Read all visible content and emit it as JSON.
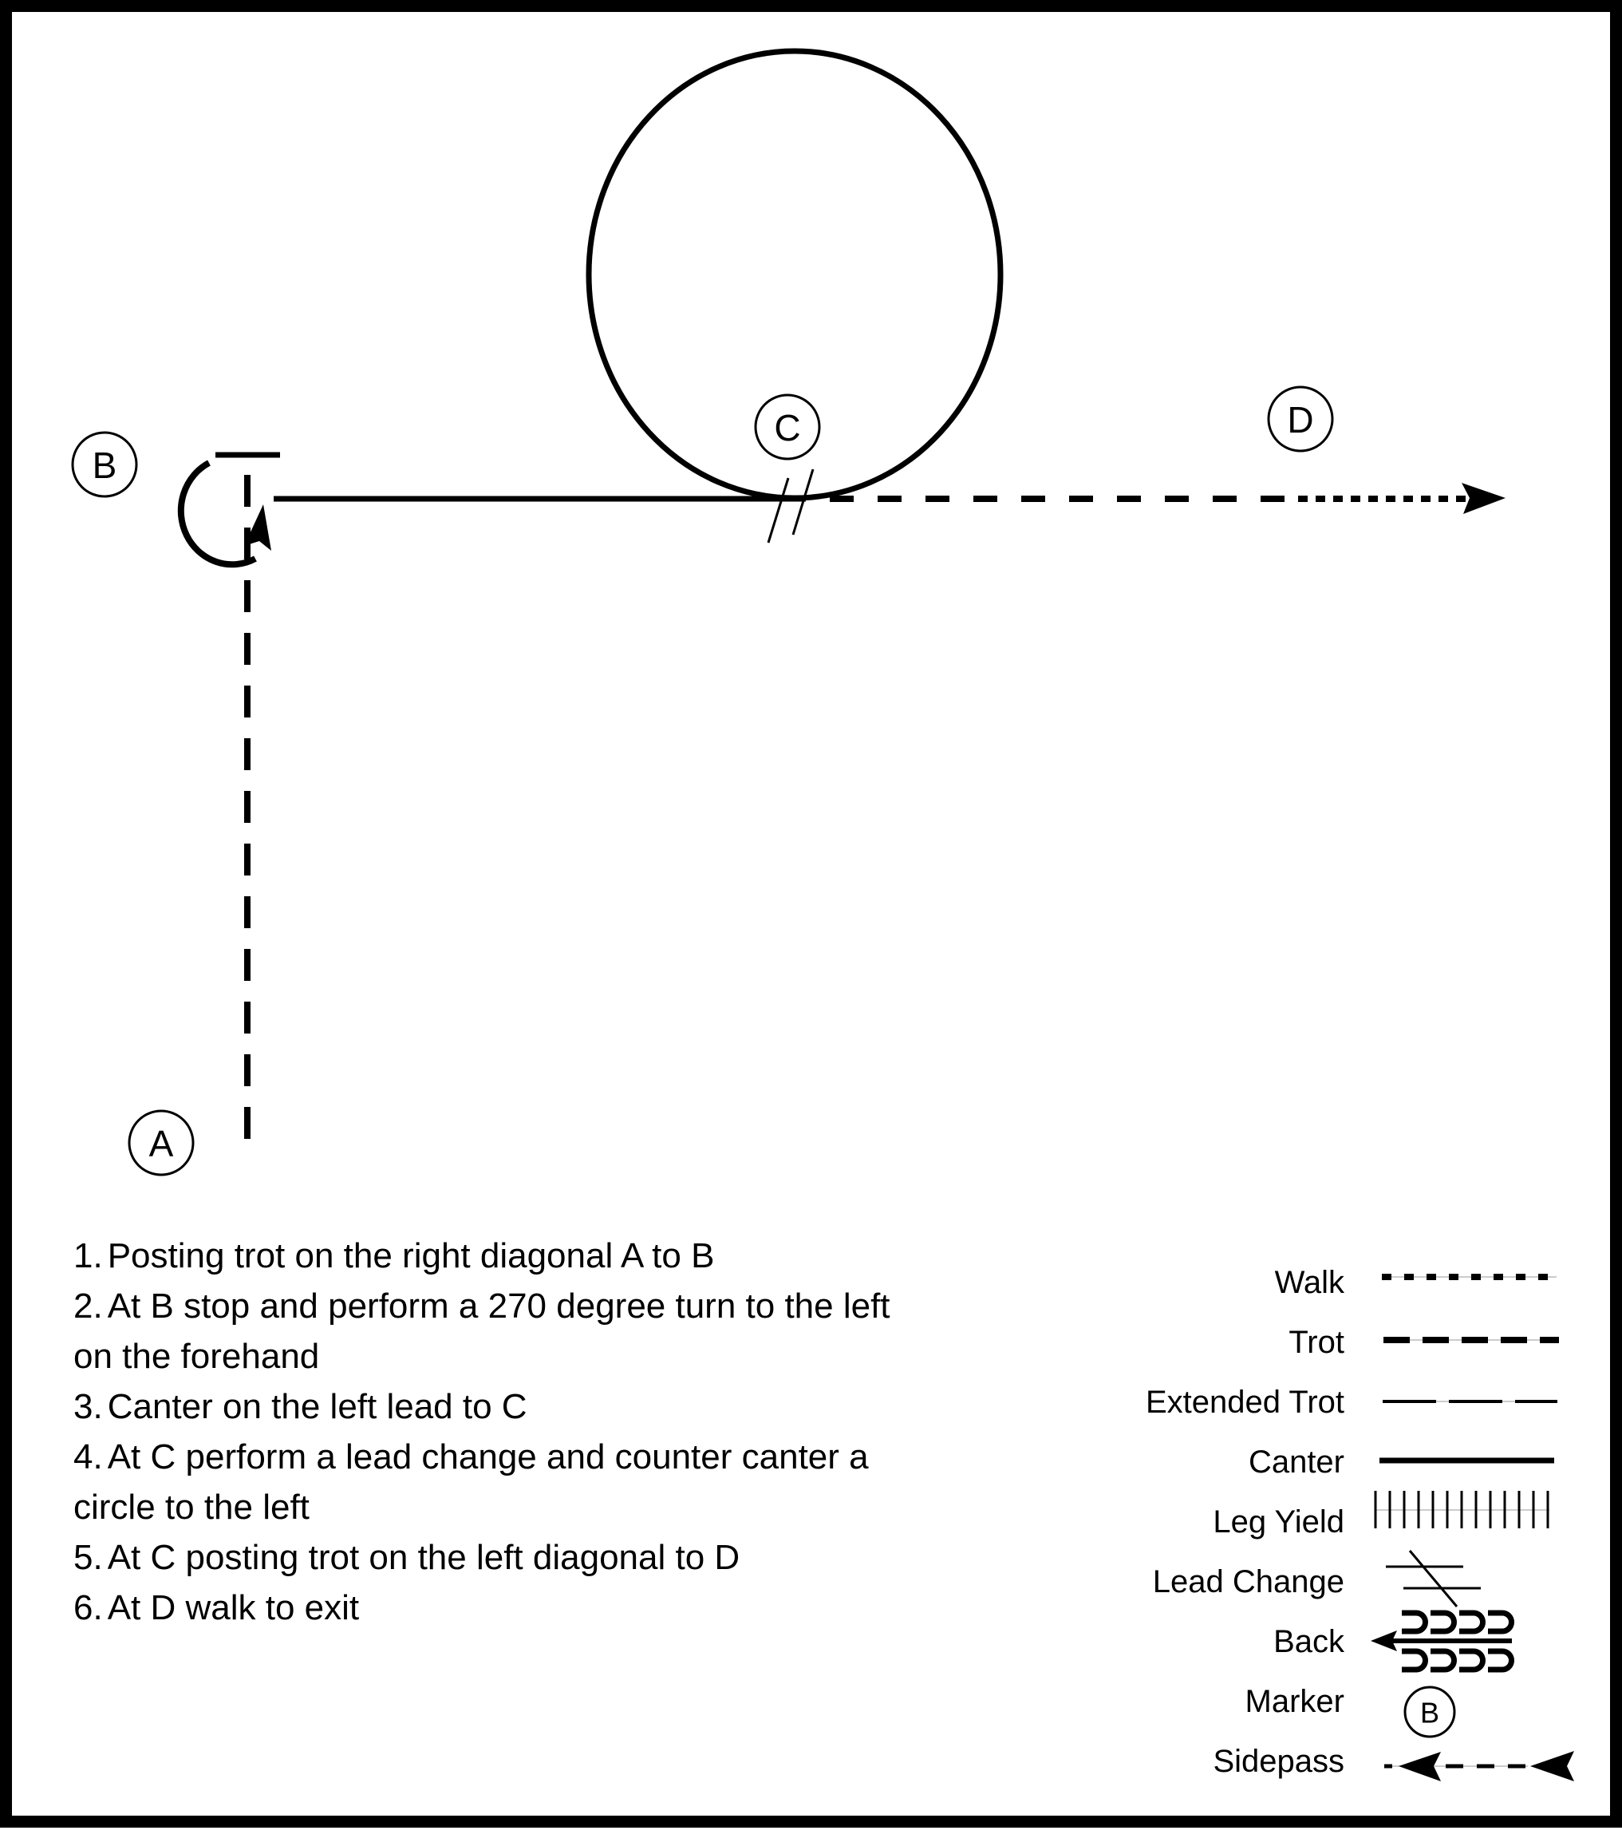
{
  "pattern": {
    "markers": [
      {
        "id": "A",
        "label": "A"
      },
      {
        "id": "B",
        "label": "B"
      },
      {
        "id": "C",
        "label": "C"
      },
      {
        "id": "D",
        "label": "D"
      }
    ],
    "segments": [
      {
        "from": "A",
        "to": "B",
        "gait": "Trot"
      },
      {
        "at": "B",
        "action": "Stop and 270 degree turn on the forehand",
        "symbol": "stop-bar"
      },
      {
        "from": "B",
        "to": "C",
        "gait": "Canter"
      },
      {
        "at": "C",
        "action": "Lead Change",
        "symbol": "lead-change-slashes"
      },
      {
        "at": "C",
        "action": "Counter canter circle to the left",
        "gait": "Canter"
      },
      {
        "from": "C",
        "to": "D",
        "gait": "Trot"
      },
      {
        "from": "D",
        "to": "exit",
        "gait": "Walk"
      }
    ]
  },
  "instructions": [
    {
      "number": "1.",
      "lines": [
        "Posting trot on the right diagonal A to B"
      ]
    },
    {
      "number": "2.",
      "lines": [
        "At B stop and perform a 270 degree turn to the left",
        "on the forehand"
      ]
    },
    {
      "number": "3.",
      "lines": [
        "Canter on the left lead to C"
      ]
    },
    {
      "number": "4.",
      "lines": [
        "At C perform a lead change and counter canter a",
        "circle to the left"
      ]
    },
    {
      "number": "5.",
      "lines": [
        "At C posting trot on the left diagonal to D"
      ]
    },
    {
      "number": "6.",
      "lines": [
        "At D walk to exit"
      ]
    }
  ],
  "legend": {
    "items": [
      {
        "label": "Walk",
        "symbol": "walk-line-icon"
      },
      {
        "label": "Trot",
        "symbol": "trot-line-icon"
      },
      {
        "label": "Extended Trot",
        "symbol": "extended-trot-line-icon"
      },
      {
        "label": "Canter",
        "symbol": "canter-line-icon"
      },
      {
        "label": "Leg Yield",
        "symbol": "leg-yield-icon"
      },
      {
        "label": "Lead Change",
        "symbol": "lead-change-icon"
      },
      {
        "label": "Back",
        "symbol": "back-icon"
      },
      {
        "label": "Marker",
        "symbol": "marker-icon",
        "marker_letter": "B"
      },
      {
        "label": "Sidepass",
        "symbol": "sidepass-icon"
      }
    ]
  },
  "colors": {
    "ink": "#000000",
    "paper": "#ffffff",
    "connector": "#bbbbbb"
  }
}
